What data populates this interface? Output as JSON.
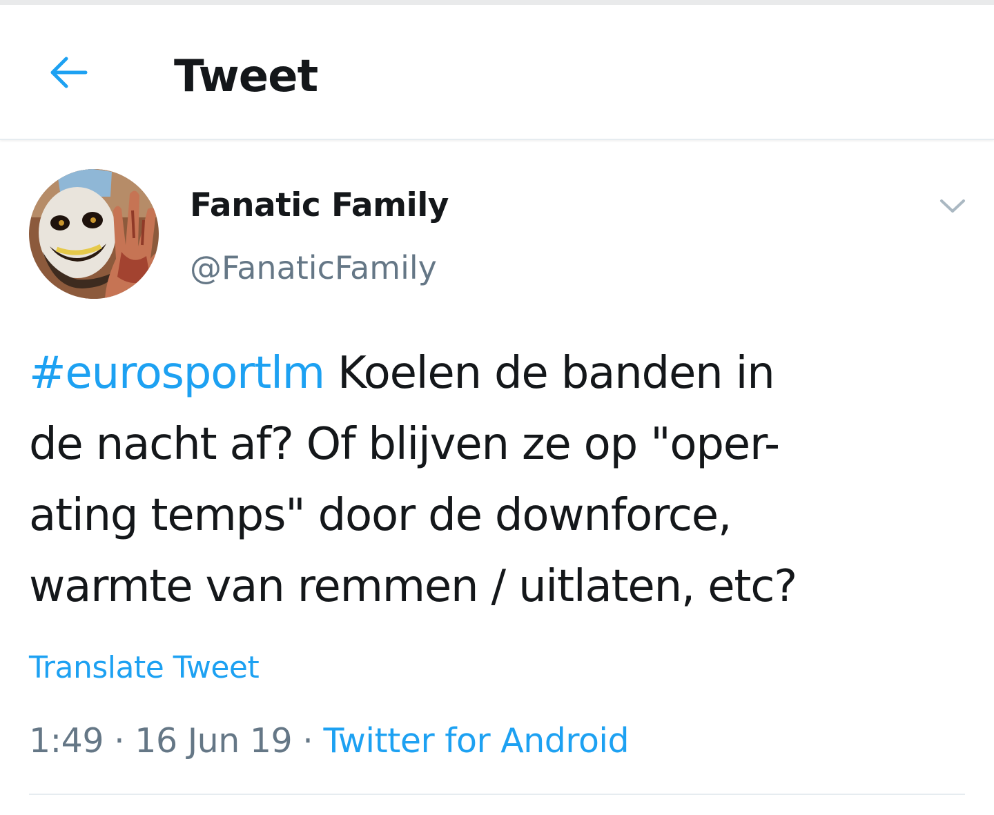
{
  "header": {
    "back_icon": "arrow-left-icon",
    "title": "Tweet"
  },
  "author": {
    "display_name": "Fanatic Family",
    "handle": "@FanaticFamily",
    "menu_icon": "chevron-down-icon"
  },
  "tweet": {
    "hashtag": "#eurosportlm",
    "text_lines": [
      " Koelen de banden in",
      "de nacht af? Of blijven ze op \"oper-",
      "ating temps\" door de downforce,",
      "warmte van remmen / uitlaten, etc?"
    ],
    "translate_label": "Translate Tweet",
    "time": "1:49",
    "separator": " · ",
    "date": "16 Jun 19",
    "source": "Twitter for Android"
  },
  "colors": {
    "accent": "#1da1f2",
    "text_primary": "#14171a",
    "text_secondary": "#657786",
    "divider": "#e6ecf0"
  }
}
